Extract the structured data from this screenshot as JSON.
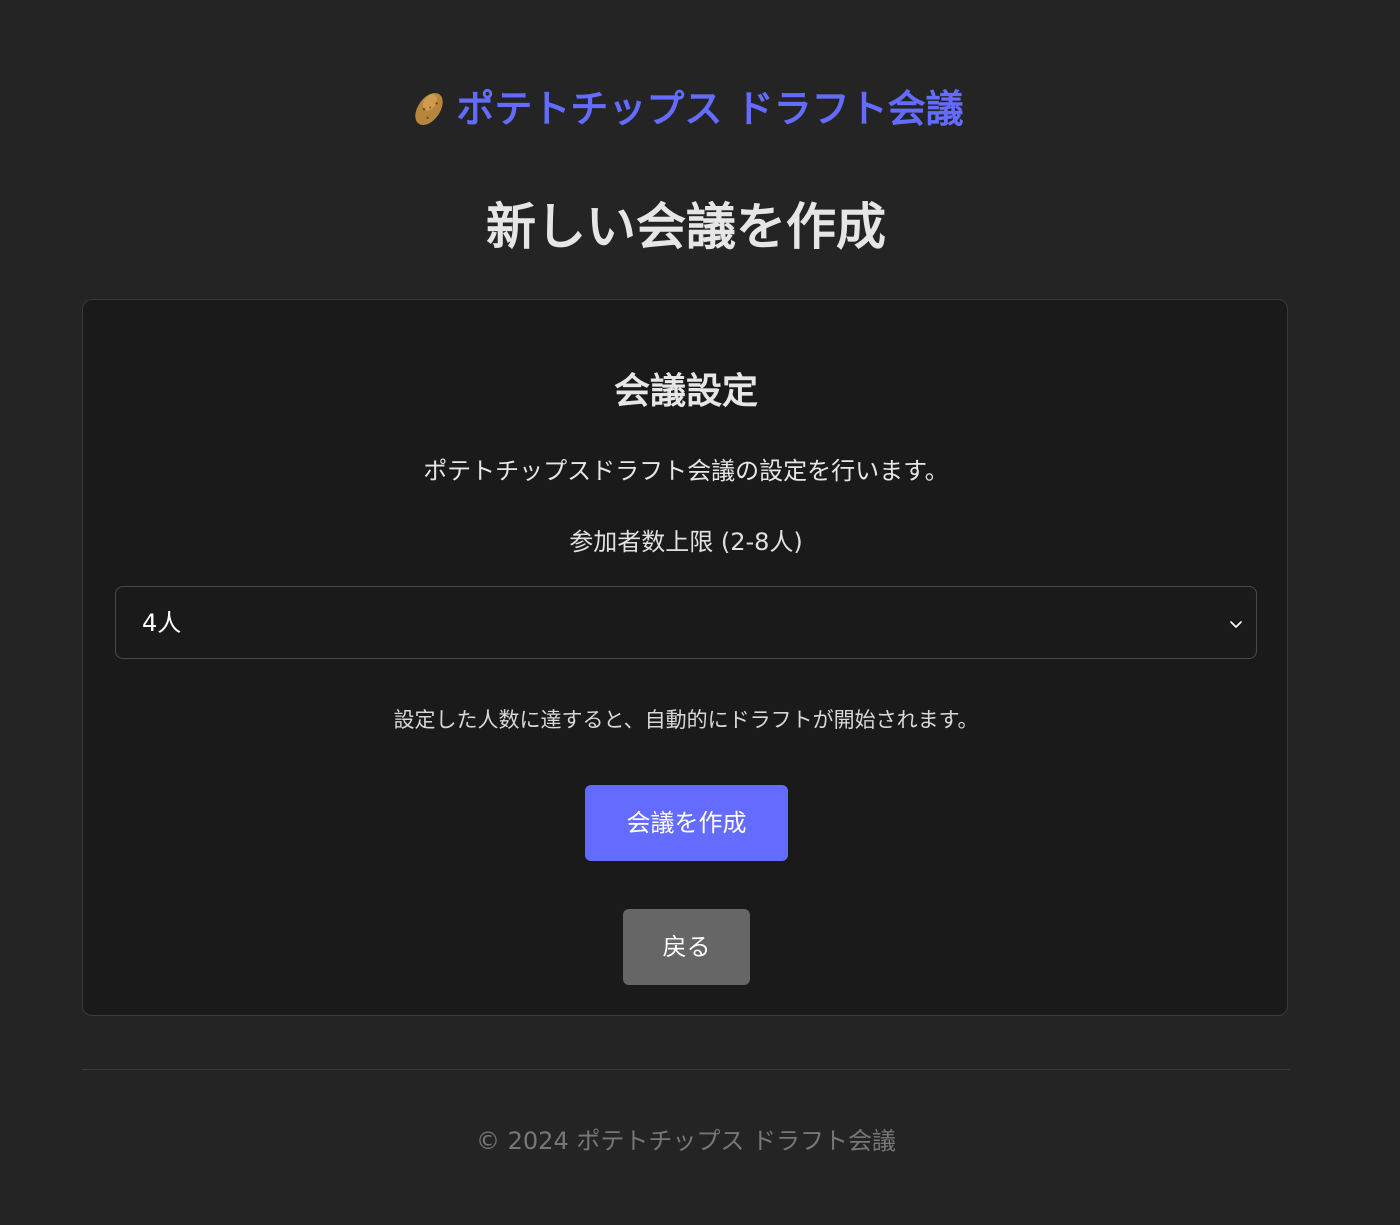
{
  "header": {
    "logo_icon": "potato-icon",
    "site_title": "ポテトチップス ドラフト会議"
  },
  "page": {
    "title": "新しい会議を作成"
  },
  "settings_card": {
    "title": "会議設定",
    "description": "ポテトチップスドラフト会議の設定を行います。",
    "participant_label": "参加者数上限 (2-8人)",
    "participant_select": {
      "selected": "4人",
      "icon": "chevron-down-icon"
    },
    "hint": "設定した人数に達すると、自動的にドラフトが開始されます。",
    "create_button": "会議を作成",
    "back_button": "戻る"
  },
  "footer": {
    "copyright": "© 2024 ポテトチップス ドラフト会議"
  },
  "colors": {
    "background": "#242424",
    "card_background": "#1a1a1a",
    "accent": "#646cff",
    "back_button": "#666666"
  }
}
